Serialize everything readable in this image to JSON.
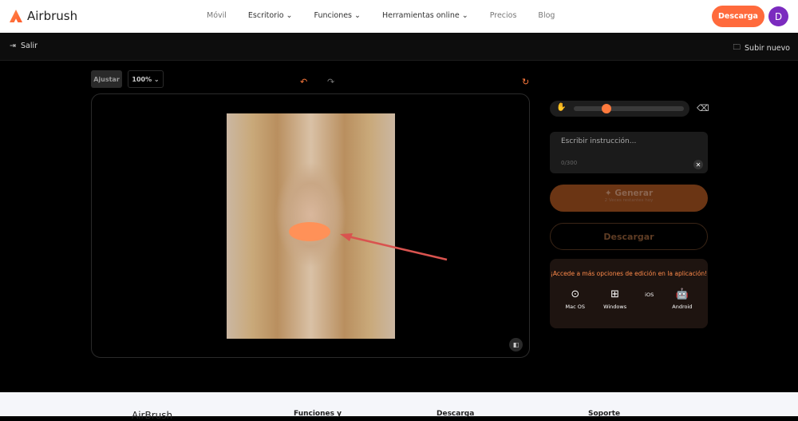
{
  "header": {
    "brand": "Airbrush",
    "menu": [
      "Móvil",
      "Escritorio ⌄",
      "Funciones ⌄",
      "Herramientas online ⌄",
      "Precios",
      "Blog"
    ],
    "download": "Descarga",
    "avatar": "D"
  },
  "toolbar": {
    "exit": "Salir",
    "upload": "Subir nuevo",
    "fit": "Ajustar",
    "zoom": "100%"
  },
  "panel": {
    "brush_size_pct": 30,
    "prompt_placeholder": "Escribir instrucción...",
    "counter": "0/300",
    "generate": "Generar",
    "remaining": "2 Veces restantes hoy",
    "download": "Descargar",
    "promo": "¡Accede a más opciones de edición en la aplicación!",
    "platforms": [
      {
        "label": "Mac OS",
        "icon": "macos-icon"
      },
      {
        "label": "Windows",
        "icon": "windows-icon"
      },
      {
        "label": "iOS",
        "icon": "apple-icon"
      },
      {
        "label": "Android",
        "icon": "android-icon"
      }
    ]
  },
  "footer": {
    "brand": "AirBrush",
    "cols": [
      "Funciones y",
      "Descarga",
      "Soporte"
    ]
  },
  "colors": {
    "accent": "#ff6a3c"
  }
}
